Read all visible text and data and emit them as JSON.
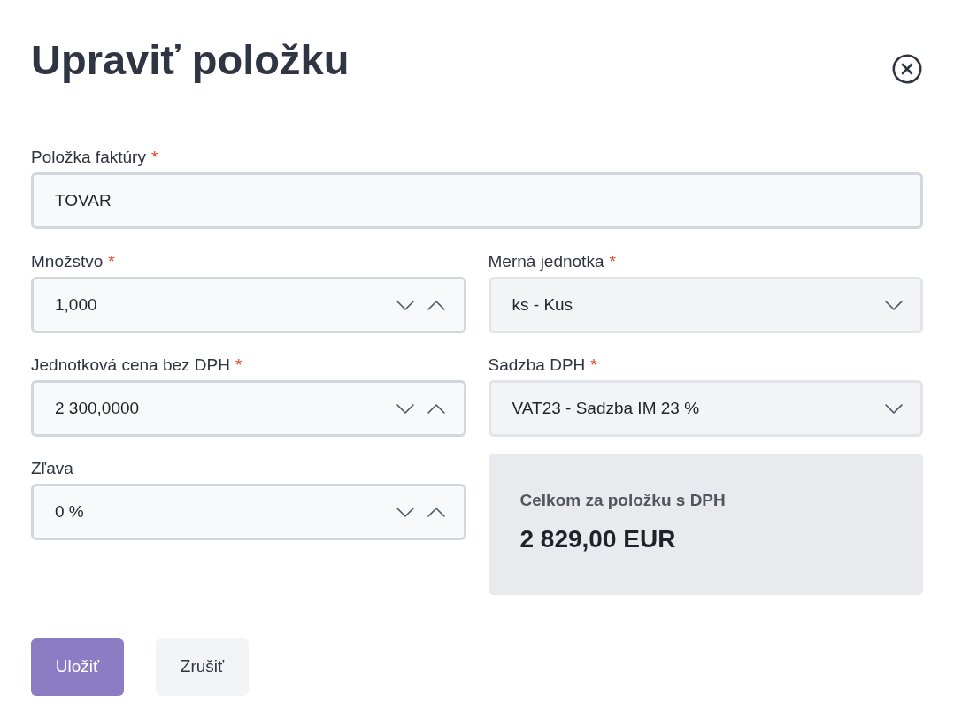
{
  "dialog": {
    "title": "Upraviť položku"
  },
  "fields": [
    {
      "label": "Položka faktúry",
      "required_mark": "*",
      "kind": "text",
      "value": "TOVAR"
    },
    {
      "label": "Množstvo",
      "required_mark": "*",
      "kind": "number",
      "value": "1,000"
    },
    {
      "label": "Merná jednotka",
      "required_mark": "*",
      "kind": "select",
      "value": "ks - Kus"
    },
    {
      "label": "Jednotková cena bez DPH",
      "required_mark": "*",
      "kind": "number",
      "value": "2 300,0000"
    },
    {
      "label": "Sadzba DPH",
      "required_mark": "*",
      "kind": "select",
      "value": "VAT23 - Sadzba IM 23 %"
    },
    {
      "label": "Zľava",
      "kind": "number",
      "value": "0 %"
    }
  ],
  "total": {
    "label": "Celkom za položku s DPH",
    "value": "2 829,00 EUR"
  },
  "buttons": [
    {
      "label": "Uložiť",
      "kind": "primary"
    },
    {
      "label": "Zrušiť",
      "kind": "secondary"
    }
  ]
}
